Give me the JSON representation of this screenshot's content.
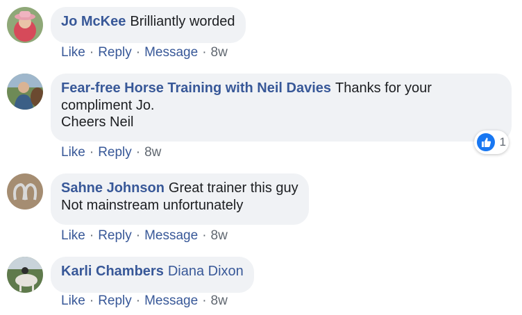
{
  "comments": [
    {
      "author": "Jo McKee",
      "lines": [
        "Brilliantly worded"
      ],
      "actions": {
        "like": "Like",
        "reply": "Reply",
        "message": "Message",
        "time": "8w"
      },
      "avatar": "avatar-pink-hat"
    },
    {
      "author": "Fear-free Horse Training with Neil Davies",
      "lines": [
        "Thanks for your",
        "compliment Jo.",
        "Cheers Neil"
      ],
      "actions": {
        "like": "Like",
        "reply": "Reply",
        "time": "8w"
      },
      "reactions": {
        "icon": "thumbs-up-icon",
        "count": "1"
      },
      "avatar": "avatar-man-horse"
    },
    {
      "author": "Sahne Johnson",
      "lines": [
        "Great trainer this guy",
        "Not mainstream unfortunately"
      ],
      "actions": {
        "like": "Like",
        "reply": "Reply",
        "message": "Message",
        "time": "8w"
      },
      "avatar": "avatar-horseshoes"
    },
    {
      "author": "Karli Chambers",
      "lines": [
        "Diana Dixon"
      ],
      "actions": {
        "like": "Like",
        "reply": "Reply",
        "message": "Message",
        "time": "8w"
      },
      "avatar": "avatar-horse-rider"
    }
  ],
  "colors": {
    "link": "#385898",
    "bubble": "#f0f2f5",
    "meta": "#606770",
    "like": "#1877f2"
  }
}
